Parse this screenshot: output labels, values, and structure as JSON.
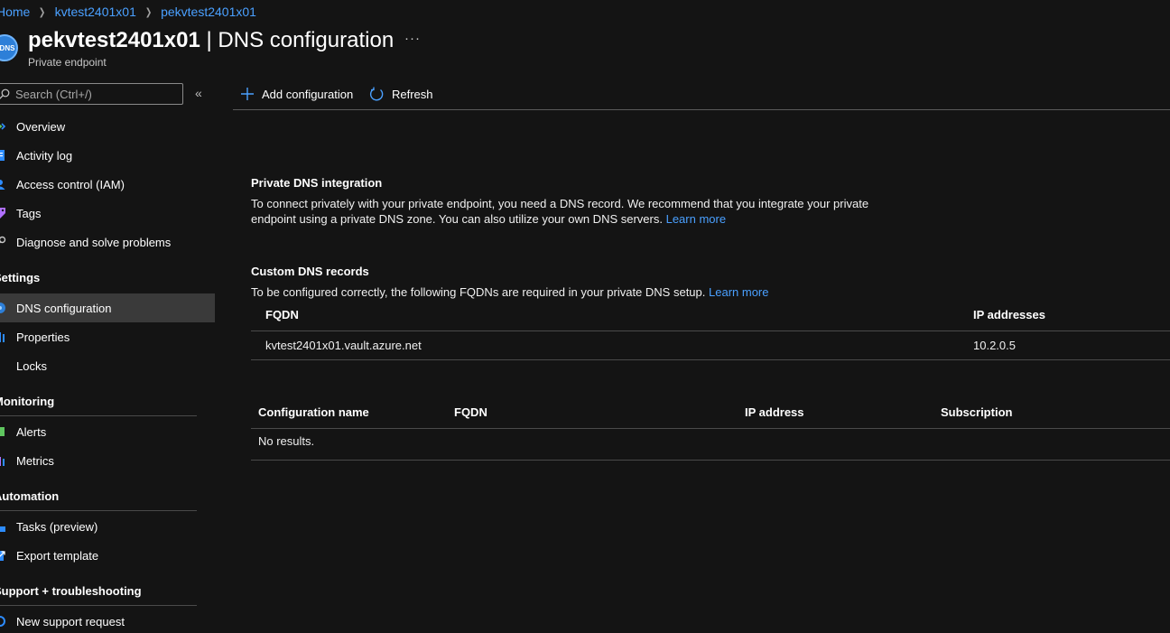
{
  "breadcrumb": [
    "Home",
    "kvtest2401x01",
    "pekvtest2401x01"
  ],
  "header": {
    "icon_text": "DNS",
    "title_bold": "pekvtest2401x01",
    "title_rest": " | DNS configuration",
    "more": "···",
    "subtitle": "Private endpoint"
  },
  "search": {
    "placeholder": "Search (Ctrl+/)"
  },
  "collapse": "«",
  "sidebar": {
    "items": [
      {
        "label": "Overview",
        "icon": "overview-icon"
      },
      {
        "label": "Activity log",
        "icon": "activity-log-icon"
      },
      {
        "label": "Access control (IAM)",
        "icon": "iam-icon"
      },
      {
        "label": "Tags",
        "icon": "tag-icon"
      },
      {
        "label": "Diagnose and solve problems",
        "icon": "wrench-icon"
      }
    ],
    "settings_label": "Settings",
    "settings_items": [
      {
        "label": "DNS configuration",
        "icon": "dns-icon"
      },
      {
        "label": "Properties",
        "icon": "properties-icon"
      },
      {
        "label": "Locks",
        "icon": "lock-icon"
      }
    ],
    "monitoring_label": "Monitoring",
    "monitoring_items": [
      {
        "label": "Alerts",
        "icon": "alert-icon"
      },
      {
        "label": "Metrics",
        "icon": "metrics-icon"
      }
    ],
    "automation_label": "Automation",
    "automation_items": [
      {
        "label": "Tasks (preview)",
        "icon": "tasks-icon"
      },
      {
        "label": "Export template",
        "icon": "export-icon"
      }
    ],
    "support_label": "Support + troubleshooting",
    "support_items": [
      {
        "label": "New support request",
        "icon": "support-icon"
      }
    ]
  },
  "toolbar": {
    "add_label": "Add configuration",
    "refresh_label": "Refresh"
  },
  "integration": {
    "title": "Private DNS integration",
    "text": "To connect privately with your private endpoint, you need a DNS record. We recommend that you integrate your private endpoint using a private DNS zone. You can also utilize your own DNS servers. ",
    "link": "Learn more"
  },
  "custom": {
    "title": "Custom DNS records",
    "text": "To be configured correctly, the following FQDNs are required in your private DNS setup. ",
    "link": "Learn more",
    "col_fqdn": "FQDN",
    "col_ip": "IP addresses",
    "rows": [
      {
        "fqdn": "kvtest2401x01.vault.azure.net",
        "ip": "10.2.0.5"
      }
    ]
  },
  "configs": {
    "col_name": "Configuration name",
    "col_fqdn": "FQDN",
    "col_ip": "IP address",
    "col_sub": "Subscription",
    "empty": "No results."
  },
  "colors": {
    "link": "#4aa0ff",
    "bg": "#141414",
    "active": "#3a3a3a"
  }
}
